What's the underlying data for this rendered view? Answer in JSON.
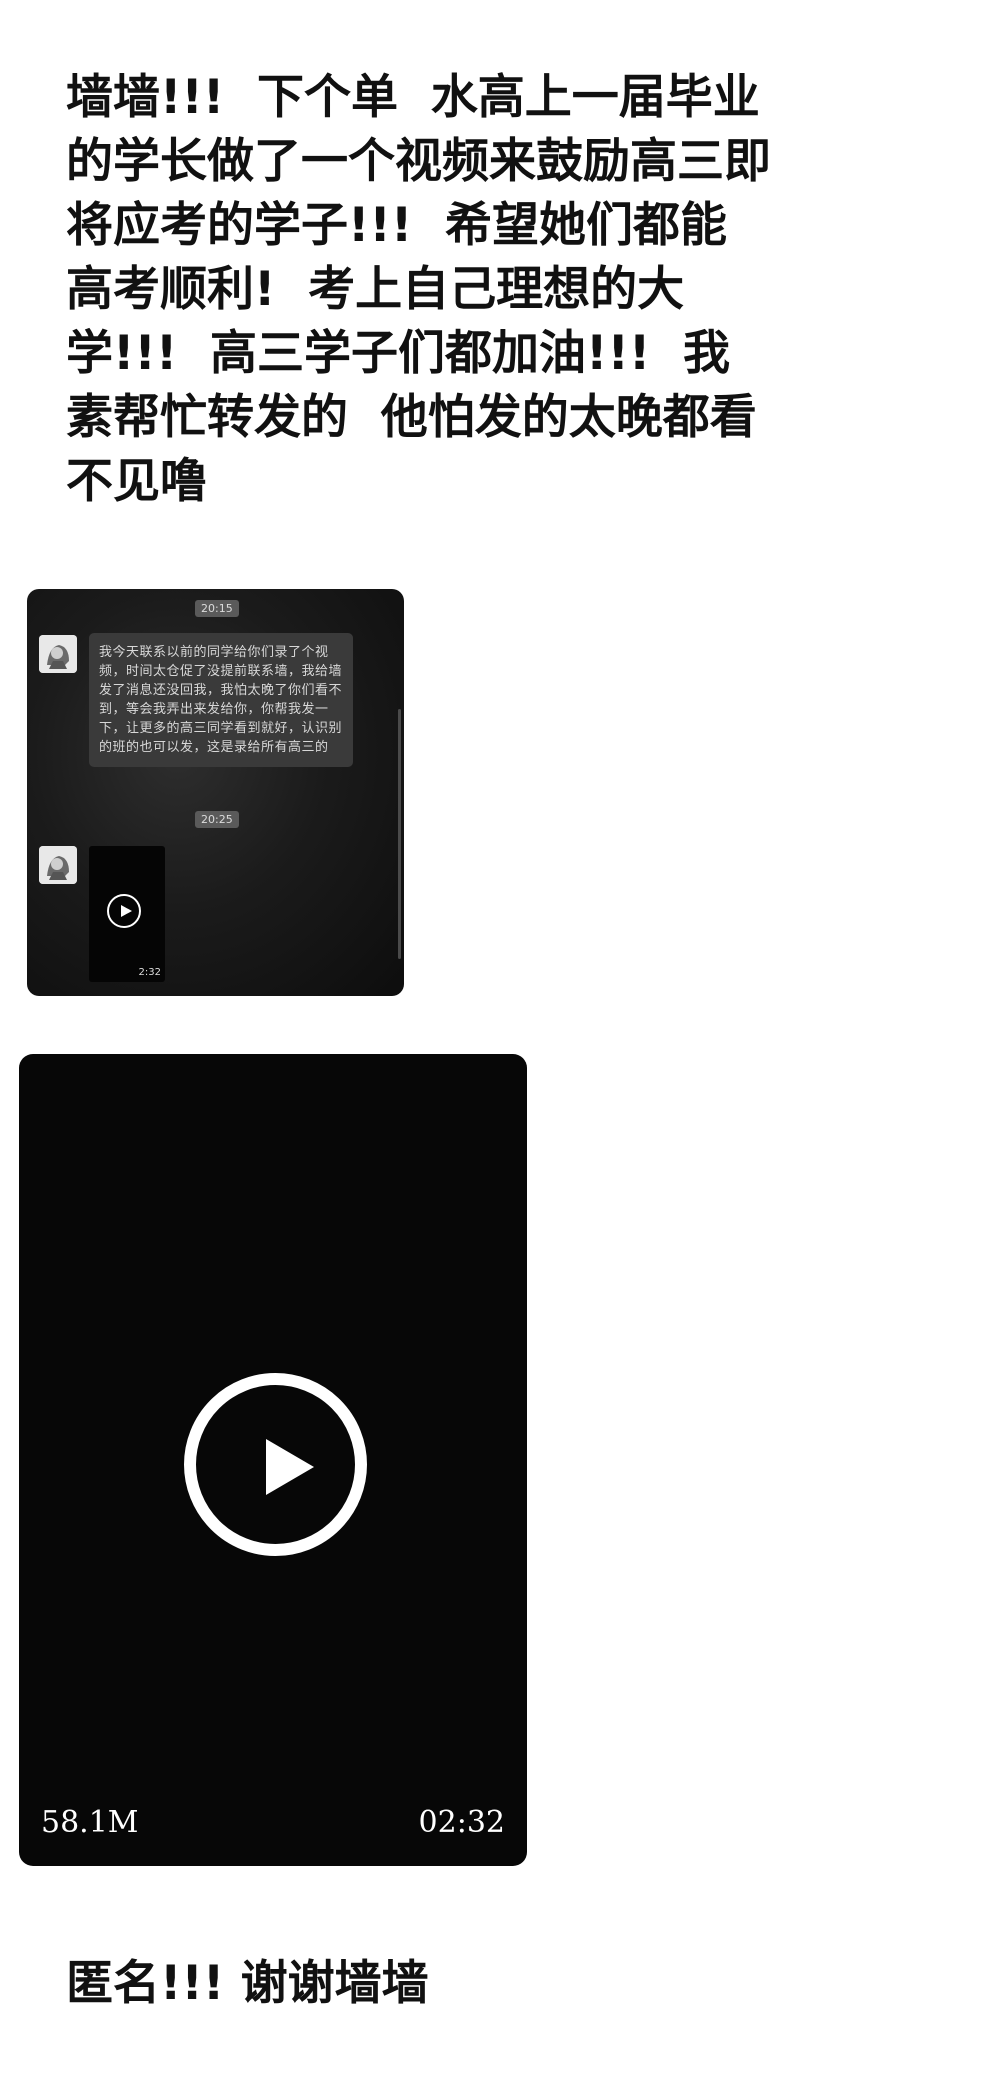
{
  "post": {
    "body": "墙墙!!!  下个单  水高上一届毕业\n的学长做了一个视频来鼓励高三即\n将应考的学子!!!  希望她们都能\n高考顺利!  考上自己理想的大\n学!!!  高三学子们都加油!!!  我\n素帮忙转发的  他怕发的太晚都看\n不见噜",
    "footer": "匿名!!!  谢谢墙墙"
  },
  "chat_screenshot": {
    "time_1": "20:15",
    "message": "我今天联系以前的同学给你们录了个视频，时间太仓促了没提前联系墙，我给墙发了消息还没回我，我怕太晚了你们看不到，等会我弄出来发给你，你帮我发一下，让更多的高三同学看到就好，认识别的班的也可以发，这是录给所有高三的",
    "time_2": "20:25",
    "mini_video_duration": "2:32"
  },
  "video": {
    "size": "58.1M",
    "duration": "02:32"
  },
  "icons": [
    "avatar-icon",
    "play-icon"
  ],
  "colors": {
    "background": "#ffffff",
    "text": "#111111",
    "video_bg": "#070707",
    "bubble": "#3a3a3a"
  }
}
